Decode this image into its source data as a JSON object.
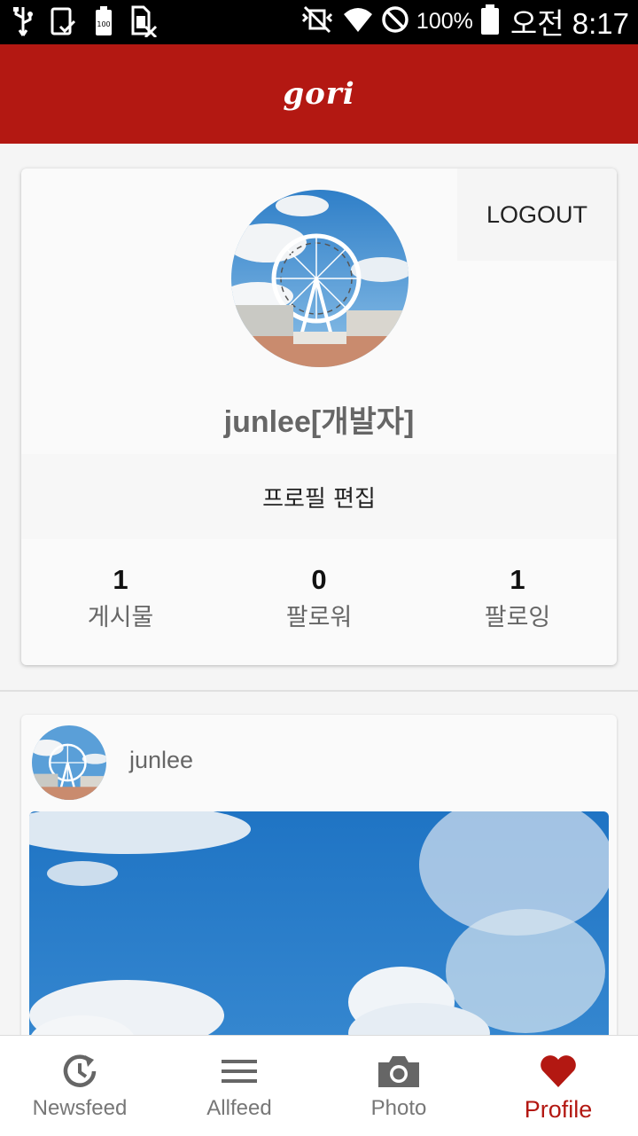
{
  "status_bar": {
    "battery_percent": "100%",
    "time": "오전 8:17",
    "icons": [
      "usb-icon",
      "download-done-icon",
      "battery-saver-icon",
      "no-sim-icon",
      "mute-vibrate-icon",
      "wifi-icon",
      "do-not-disturb-icon",
      "battery-icon"
    ]
  },
  "app_bar": {
    "title": "gori"
  },
  "profile": {
    "logout_label": "LOGOUT",
    "username": "junlee[개발자]",
    "edit_label": "프로필 편집",
    "stats": [
      {
        "value": "1",
        "label": "게시물"
      },
      {
        "value": "0",
        "label": "팔로워"
      },
      {
        "value": "1",
        "label": "팔로잉"
      }
    ]
  },
  "post": {
    "username": "junlee"
  },
  "bottom_nav": {
    "items": [
      {
        "label": "Newsfeed",
        "icon": "history-icon",
        "active": false
      },
      {
        "label": "Allfeed",
        "icon": "menu-lines-icon",
        "active": false
      },
      {
        "label": "Photo",
        "icon": "camera-icon",
        "active": false
      },
      {
        "label": "Profile",
        "icon": "heart-icon",
        "active": true
      }
    ]
  },
  "colors": {
    "accent": "#b31812",
    "background": "#f5f5f5",
    "card": "#fafafa"
  }
}
